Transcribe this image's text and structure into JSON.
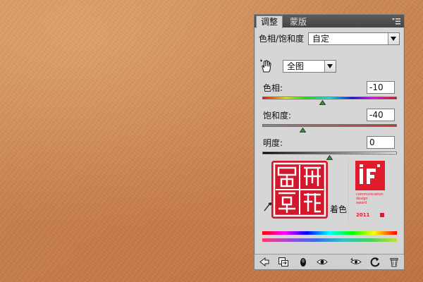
{
  "panel": {
    "tabs": [
      {
        "label": "调整"
      },
      {
        "label": "蒙版"
      }
    ],
    "adjustment_label": "色相/饱和度",
    "preset_value": "自定",
    "channel_value": "全图",
    "hue": {
      "label": "色相:",
      "value": "-10",
      "position": 0.45
    },
    "saturation": {
      "label": "饱和度:",
      "value": "-40",
      "position": 0.3
    },
    "lightness": {
      "label": "明度:",
      "value": "0",
      "position": 0.5
    },
    "colorize_label": "着色",
    "stamp": {
      "seal_text": "原创精品",
      "if_logo_text": "iF",
      "if_award_lines": [
        "communication",
        "design",
        "award"
      ],
      "if_year": "2011"
    }
  },
  "colors": {
    "background": "#c98250",
    "panel": "#d6d6d6",
    "tabbar": "#4e4e4e",
    "seal_red": "#d4182b"
  },
  "icons": [
    "panel-menu-icon",
    "hand-target-icon",
    "back-arrow-icon",
    "clip-layer-icon",
    "mask-visibility-icon",
    "eye-icon",
    "view-previous-icon",
    "reset-icon",
    "trash-icon",
    "colorize-eyedropper-icon"
  ]
}
